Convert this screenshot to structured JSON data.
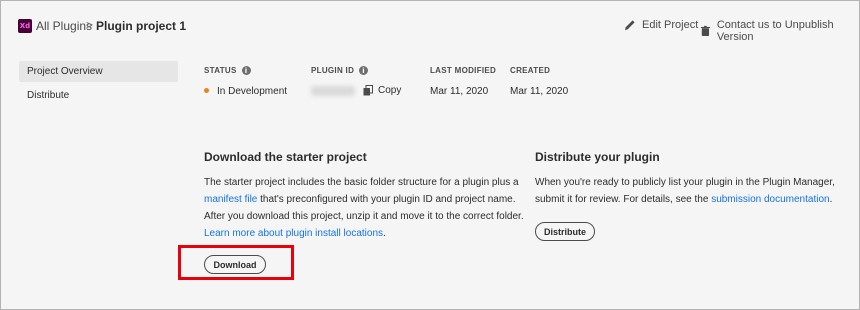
{
  "header": {
    "app_badge": "Xd",
    "breadcrumb_root": "All Plugins",
    "breadcrumb_separator": ">",
    "breadcrumb_current": "Plugin project 1",
    "edit_label": "Edit Project",
    "contact_label": "Contact us to Unpublish Version"
  },
  "sidebar": {
    "items": [
      {
        "label": "Project Overview",
        "active": true
      },
      {
        "label": "Distribute",
        "active": false
      }
    ]
  },
  "meta": {
    "status_label": "STATUS",
    "status_value": "In Development",
    "status_color": "#e68619",
    "plugin_id_label": "PLUGIN ID",
    "copy_label": "Copy",
    "last_modified_label": "LAST MODIFIED",
    "last_modified_value": "Mar 11, 2020",
    "created_label": "CREATED",
    "created_value": "Mar 11, 2020"
  },
  "starter": {
    "title": "Download the starter project",
    "text_1": "The starter project includes the basic folder structure for a plugin plus a",
    "link_manifest": "manifest file",
    "text_2": " that's preconfigured with your plugin ID and project name. After you download this project, unzip it and move it to the correct folder. ",
    "link_learn": "Learn more about plugin install locations",
    "text_3": ".",
    "button": "Download"
  },
  "distribute": {
    "title": "Distribute your plugin",
    "text_1": "When you're ready to publicly list your plugin in the Plugin Manager, submit it for review. For details, see the ",
    "link_submission": "submission documentation",
    "text_2": ".",
    "button": "Distribute"
  },
  "colors": {
    "link": "#1473e6",
    "highlight": "#e8000b",
    "xd_brand": "#470137"
  }
}
